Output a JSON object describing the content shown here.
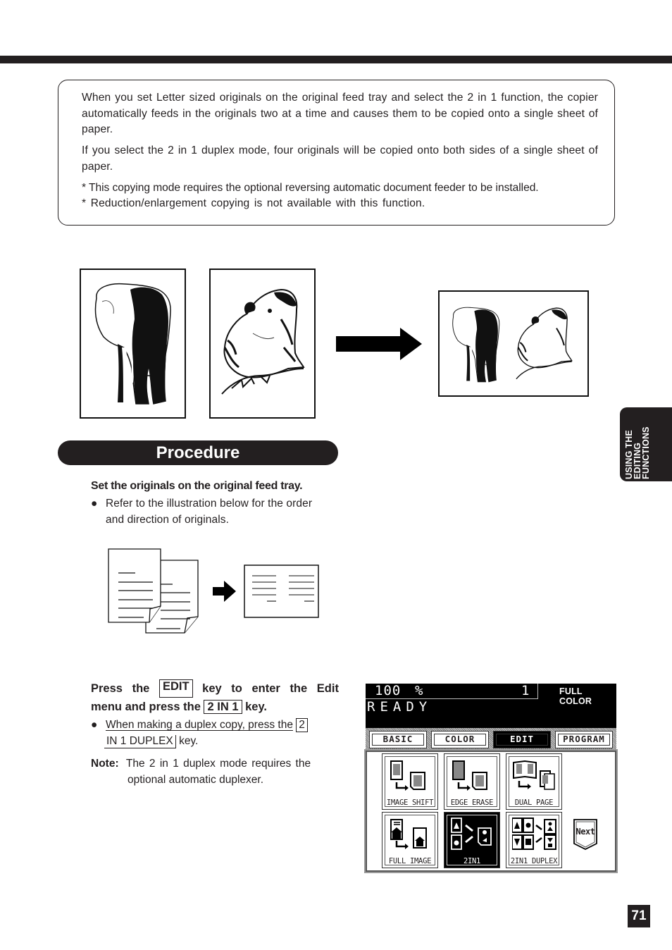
{
  "intro": {
    "paragraphs": [
      "When you set Letter sized originals on the original feed tray and select the 2 in 1 function, the copier automatically feeds in the originals two at a time and causes them to be copied onto a single sheet of paper.",
      "If you select the 2 in 1 duplex mode, four originals will be copied onto both sides of a single sheet of paper."
    ],
    "notes": [
      "* This copying mode requires the optional reversing automatic document feeder to be installed.",
      "* Reduction/enlargement copying is not available with this function."
    ]
  },
  "illustration": {
    "originals": [
      "elephant-original",
      "marmot-original"
    ],
    "result": "2-in-1-copy"
  },
  "side_tab": {
    "lines": [
      "USING THE",
      "EDITING",
      "FUNCTIONS"
    ]
  },
  "procedure": {
    "title": "Procedure",
    "step1": {
      "title": "Set the originals on the original feed tray.",
      "bullet_line1": "Refer to the illustration below for the order",
      "bullet_line2": "and direction of originals."
    },
    "step2": {
      "w_press": "Press",
      "w_the": "the",
      "key_edit": "EDIT",
      "w_key": "key",
      "w_to": "to",
      "w_enter": "enter",
      "w_the2": "the",
      "w_edit": "Edit",
      "line2_pre": "menu and press the",
      "key_2in1": "2 IN 1",
      "line2_post": "key.",
      "bullet_pre": "When making a duplex copy, press the",
      "key_duplex_a": "2",
      "key_duplex_b": "IN 1 DUPLEX",
      "bullet_post": "key."
    },
    "note": {
      "label": "Note:",
      "line1": "The 2 in 1 duplex mode requires the",
      "line2": "optional automatic duplexer."
    }
  },
  "panel": {
    "zoom": "100",
    "zoom_unit": "%",
    "copies": "1",
    "color_mode": "FULL COLOR",
    "status": "READY",
    "tabs": [
      {
        "label": "BASIC",
        "active": false
      },
      {
        "label": "COLOR",
        "active": false
      },
      {
        "label": "EDIT",
        "active": true
      },
      {
        "label": "PROGRAM",
        "active": false
      }
    ],
    "functions": [
      {
        "label": "IMAGE SHIFT",
        "active": false
      },
      {
        "label": "EDGE ERASE",
        "active": false
      },
      {
        "label": "DUAL  PAGE",
        "active": false
      },
      {
        "label": "FULL IMAGE",
        "active": false
      },
      {
        "label": "2IN1",
        "active": true
      },
      {
        "label": "2IN1 DUPLEX",
        "active": false
      }
    ],
    "next_label": "Next"
  },
  "page_number": "71"
}
